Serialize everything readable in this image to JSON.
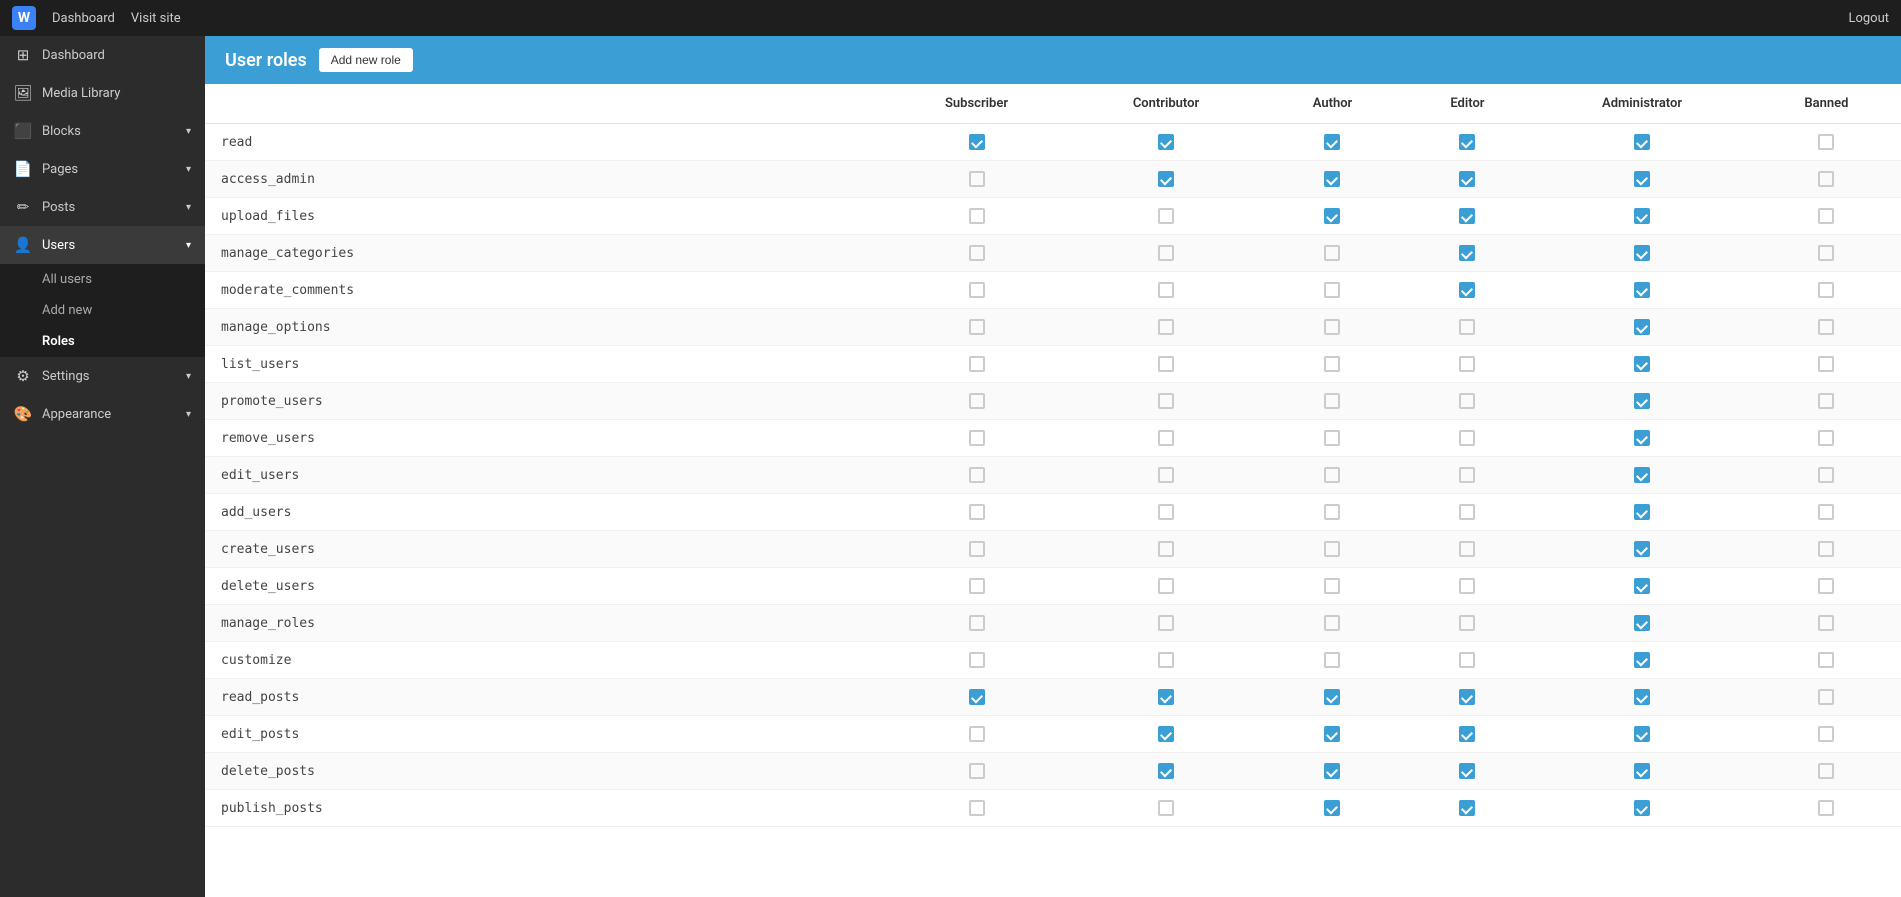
{
  "topbar": {
    "logo_text": "W",
    "dashboard_label": "Dashboard",
    "visit_site_label": "Visit site",
    "logout_label": "Logout"
  },
  "sidebar": {
    "items": [
      {
        "id": "dashboard",
        "label": "Dashboard",
        "icon": "⊞",
        "has_children": false
      },
      {
        "id": "media",
        "label": "Media Library",
        "icon": "🖼",
        "has_children": false
      },
      {
        "id": "blocks",
        "label": "Blocks",
        "icon": "⬛",
        "has_children": true
      },
      {
        "id": "pages",
        "label": "Pages",
        "icon": "📄",
        "has_children": true
      },
      {
        "id": "posts",
        "label": "Posts",
        "icon": "✏️",
        "has_children": true
      },
      {
        "id": "users",
        "label": "Users",
        "icon": "👤",
        "has_children": true
      },
      {
        "id": "settings",
        "label": "Settings",
        "icon": "⚙",
        "has_children": true
      },
      {
        "id": "appearance",
        "label": "Appearance",
        "icon": "🎨",
        "has_children": true
      }
    ],
    "users_subitems": [
      {
        "id": "all-users",
        "label": "All users"
      },
      {
        "id": "add-new",
        "label": "Add new"
      },
      {
        "id": "roles",
        "label": "Roles"
      }
    ]
  },
  "page": {
    "title": "User roles",
    "add_role_button": "Add new role"
  },
  "table": {
    "columns": [
      "",
      "Subscriber",
      "Contributor",
      "Author",
      "Editor",
      "Administrator",
      "Banned"
    ],
    "rows": [
      {
        "permission": "read",
        "sub": true,
        "contrib": true,
        "author": true,
        "editor": true,
        "admin": true,
        "banned": false
      },
      {
        "permission": "access_admin",
        "sub": false,
        "contrib": true,
        "author": true,
        "editor": true,
        "admin": true,
        "banned": false
      },
      {
        "permission": "upload_files",
        "sub": false,
        "contrib": false,
        "author": true,
        "editor": true,
        "admin": true,
        "banned": false
      },
      {
        "permission": "manage_categories",
        "sub": false,
        "contrib": false,
        "author": false,
        "editor": true,
        "admin": true,
        "banned": false
      },
      {
        "permission": "moderate_comments",
        "sub": false,
        "contrib": false,
        "author": false,
        "editor": true,
        "admin": true,
        "banned": false
      },
      {
        "permission": "manage_options",
        "sub": false,
        "contrib": false,
        "author": false,
        "editor": false,
        "admin": true,
        "banned": false
      },
      {
        "permission": "list_users",
        "sub": false,
        "contrib": false,
        "author": false,
        "editor": false,
        "admin": true,
        "banned": false
      },
      {
        "permission": "promote_users",
        "sub": false,
        "contrib": false,
        "author": false,
        "editor": false,
        "admin": true,
        "banned": false
      },
      {
        "permission": "remove_users",
        "sub": false,
        "contrib": false,
        "author": false,
        "editor": false,
        "admin": true,
        "banned": false
      },
      {
        "permission": "edit_users",
        "sub": false,
        "contrib": false,
        "author": false,
        "editor": false,
        "admin": true,
        "banned": false
      },
      {
        "permission": "add_users",
        "sub": false,
        "contrib": false,
        "author": false,
        "editor": false,
        "admin": true,
        "banned": false
      },
      {
        "permission": "create_users",
        "sub": false,
        "contrib": false,
        "author": false,
        "editor": false,
        "admin": true,
        "banned": false
      },
      {
        "permission": "delete_users",
        "sub": false,
        "contrib": false,
        "author": false,
        "editor": false,
        "admin": true,
        "banned": false
      },
      {
        "permission": "manage_roles",
        "sub": false,
        "contrib": false,
        "author": false,
        "editor": false,
        "admin": true,
        "banned": false
      },
      {
        "permission": "customize",
        "sub": false,
        "contrib": false,
        "author": false,
        "editor": false,
        "admin": true,
        "banned": false
      },
      {
        "permission": "read_posts",
        "sub": true,
        "contrib": true,
        "author": true,
        "editor": true,
        "admin": true,
        "banned": false
      },
      {
        "permission": "edit_posts",
        "sub": false,
        "contrib": true,
        "author": true,
        "editor": true,
        "admin": true,
        "banned": false
      },
      {
        "permission": "delete_posts",
        "sub": false,
        "contrib": true,
        "author": true,
        "editor": true,
        "admin": true,
        "banned": false
      },
      {
        "permission": "publish_posts",
        "sub": false,
        "contrib": false,
        "author": true,
        "editor": true,
        "admin": true,
        "banned": false
      }
    ]
  }
}
